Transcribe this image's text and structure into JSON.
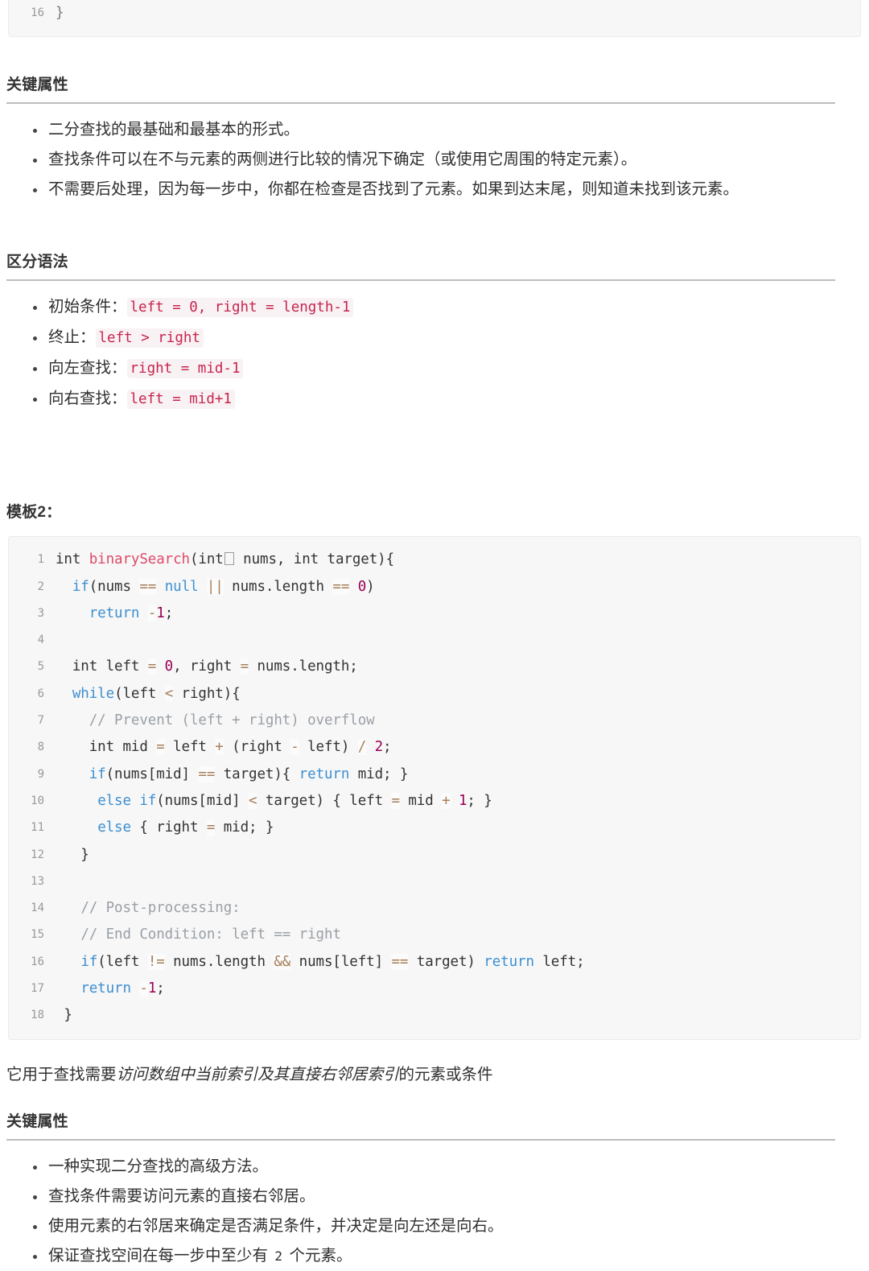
{
  "top_clipped_code": {
    "lines": [
      {
        "num": "16",
        "code": "}"
      }
    ]
  },
  "sections": [
    {
      "id": "key-properties-1",
      "heading": "关键属性",
      "bullets": [
        "二分查找的最基础和最基本的形式。",
        "查找条件可以在不与元素的两侧进行比较的情况下确定（或使用它周围的特定元素）。",
        "不需要后处理，因为每一步中，你都在检查是否找到了元素。如果到达末尾，则知道未找到该元素。"
      ]
    },
    {
      "id": "syntax-distinction",
      "heading": "区分语法",
      "bullets": [
        {
          "label": "初始条件：",
          "code": "left = 0, right = length-1"
        },
        {
          "label": "终止：",
          "code": "left > right"
        },
        {
          "label": "向左查找：",
          "code": "right = mid-1"
        },
        {
          "label": "向右查找：",
          "code": "left = mid+1"
        }
      ]
    }
  ],
  "template2": {
    "heading": "模板2：",
    "code_lines": [
      {
        "num": "1",
        "text": "int binarySearch(int[] nums, int target){"
      },
      {
        "num": "2",
        "text": "  if(nums == null || nums.length == 0)"
      },
      {
        "num": "3",
        "text": "    return -1;"
      },
      {
        "num": "4",
        "text": ""
      },
      {
        "num": "5",
        "text": "  int left = 0, right = nums.length;"
      },
      {
        "num": "6",
        "text": "  while(left < right){"
      },
      {
        "num": "7",
        "text": "    // Prevent (left + right) overflow"
      },
      {
        "num": "8",
        "text": "    int mid = left + (right - left) / 2;"
      },
      {
        "num": "9",
        "text": "    if(nums[mid] == target){ return mid; }"
      },
      {
        "num": "10",
        "text": "     else if(nums[mid] < target) { left = mid + 1; }"
      },
      {
        "num": "11",
        "text": "     else { right = mid; }"
      },
      {
        "num": "12",
        "text": "   }"
      },
      {
        "num": "13",
        "text": ""
      },
      {
        "num": "14",
        "text": "   // Post-processing:"
      },
      {
        "num": "15",
        "text": "   // End Condition: left == right"
      },
      {
        "num": "16",
        "text": "   if(left != nums.length && nums[left] == target) return left;"
      },
      {
        "num": "17",
        "text": "   return -1;"
      },
      {
        "num": "18",
        "text": " }"
      }
    ],
    "description": {
      "before": "它用于查找需要",
      "italic": "访问数组中当前索引及其直接右邻居索引",
      "after": "的元素或条件"
    },
    "key_properties": {
      "heading": "关键属性",
      "bullets": [
        {
          "text": "一种实现二分查找的高级方法。"
        },
        {
          "text": "查找条件需要访问元素的直接右邻居。"
        },
        {
          "text": "使用元素的右邻居来确定是否满足条件，并决定是向左还是向右。"
        },
        {
          "before": "保证查找空间在每一步中至少有 ",
          "mono": "2",
          "after": " 个元素。"
        }
      ]
    }
  },
  "colors": {
    "code_bg": "#f7f7f7",
    "code_border": "#ececec",
    "inline_code_text": "#c7254e",
    "inline_code_bg": "#f9f2f4",
    "rule": "#bdbdbd",
    "body_text": "#2f2f2f",
    "line_number": "#999999",
    "token_function": "#dd4a68",
    "token_keyword": "#3d8fd1",
    "token_operator": "#a67f59",
    "token_number": "#990055",
    "token_comment": "#9aa0a6"
  }
}
